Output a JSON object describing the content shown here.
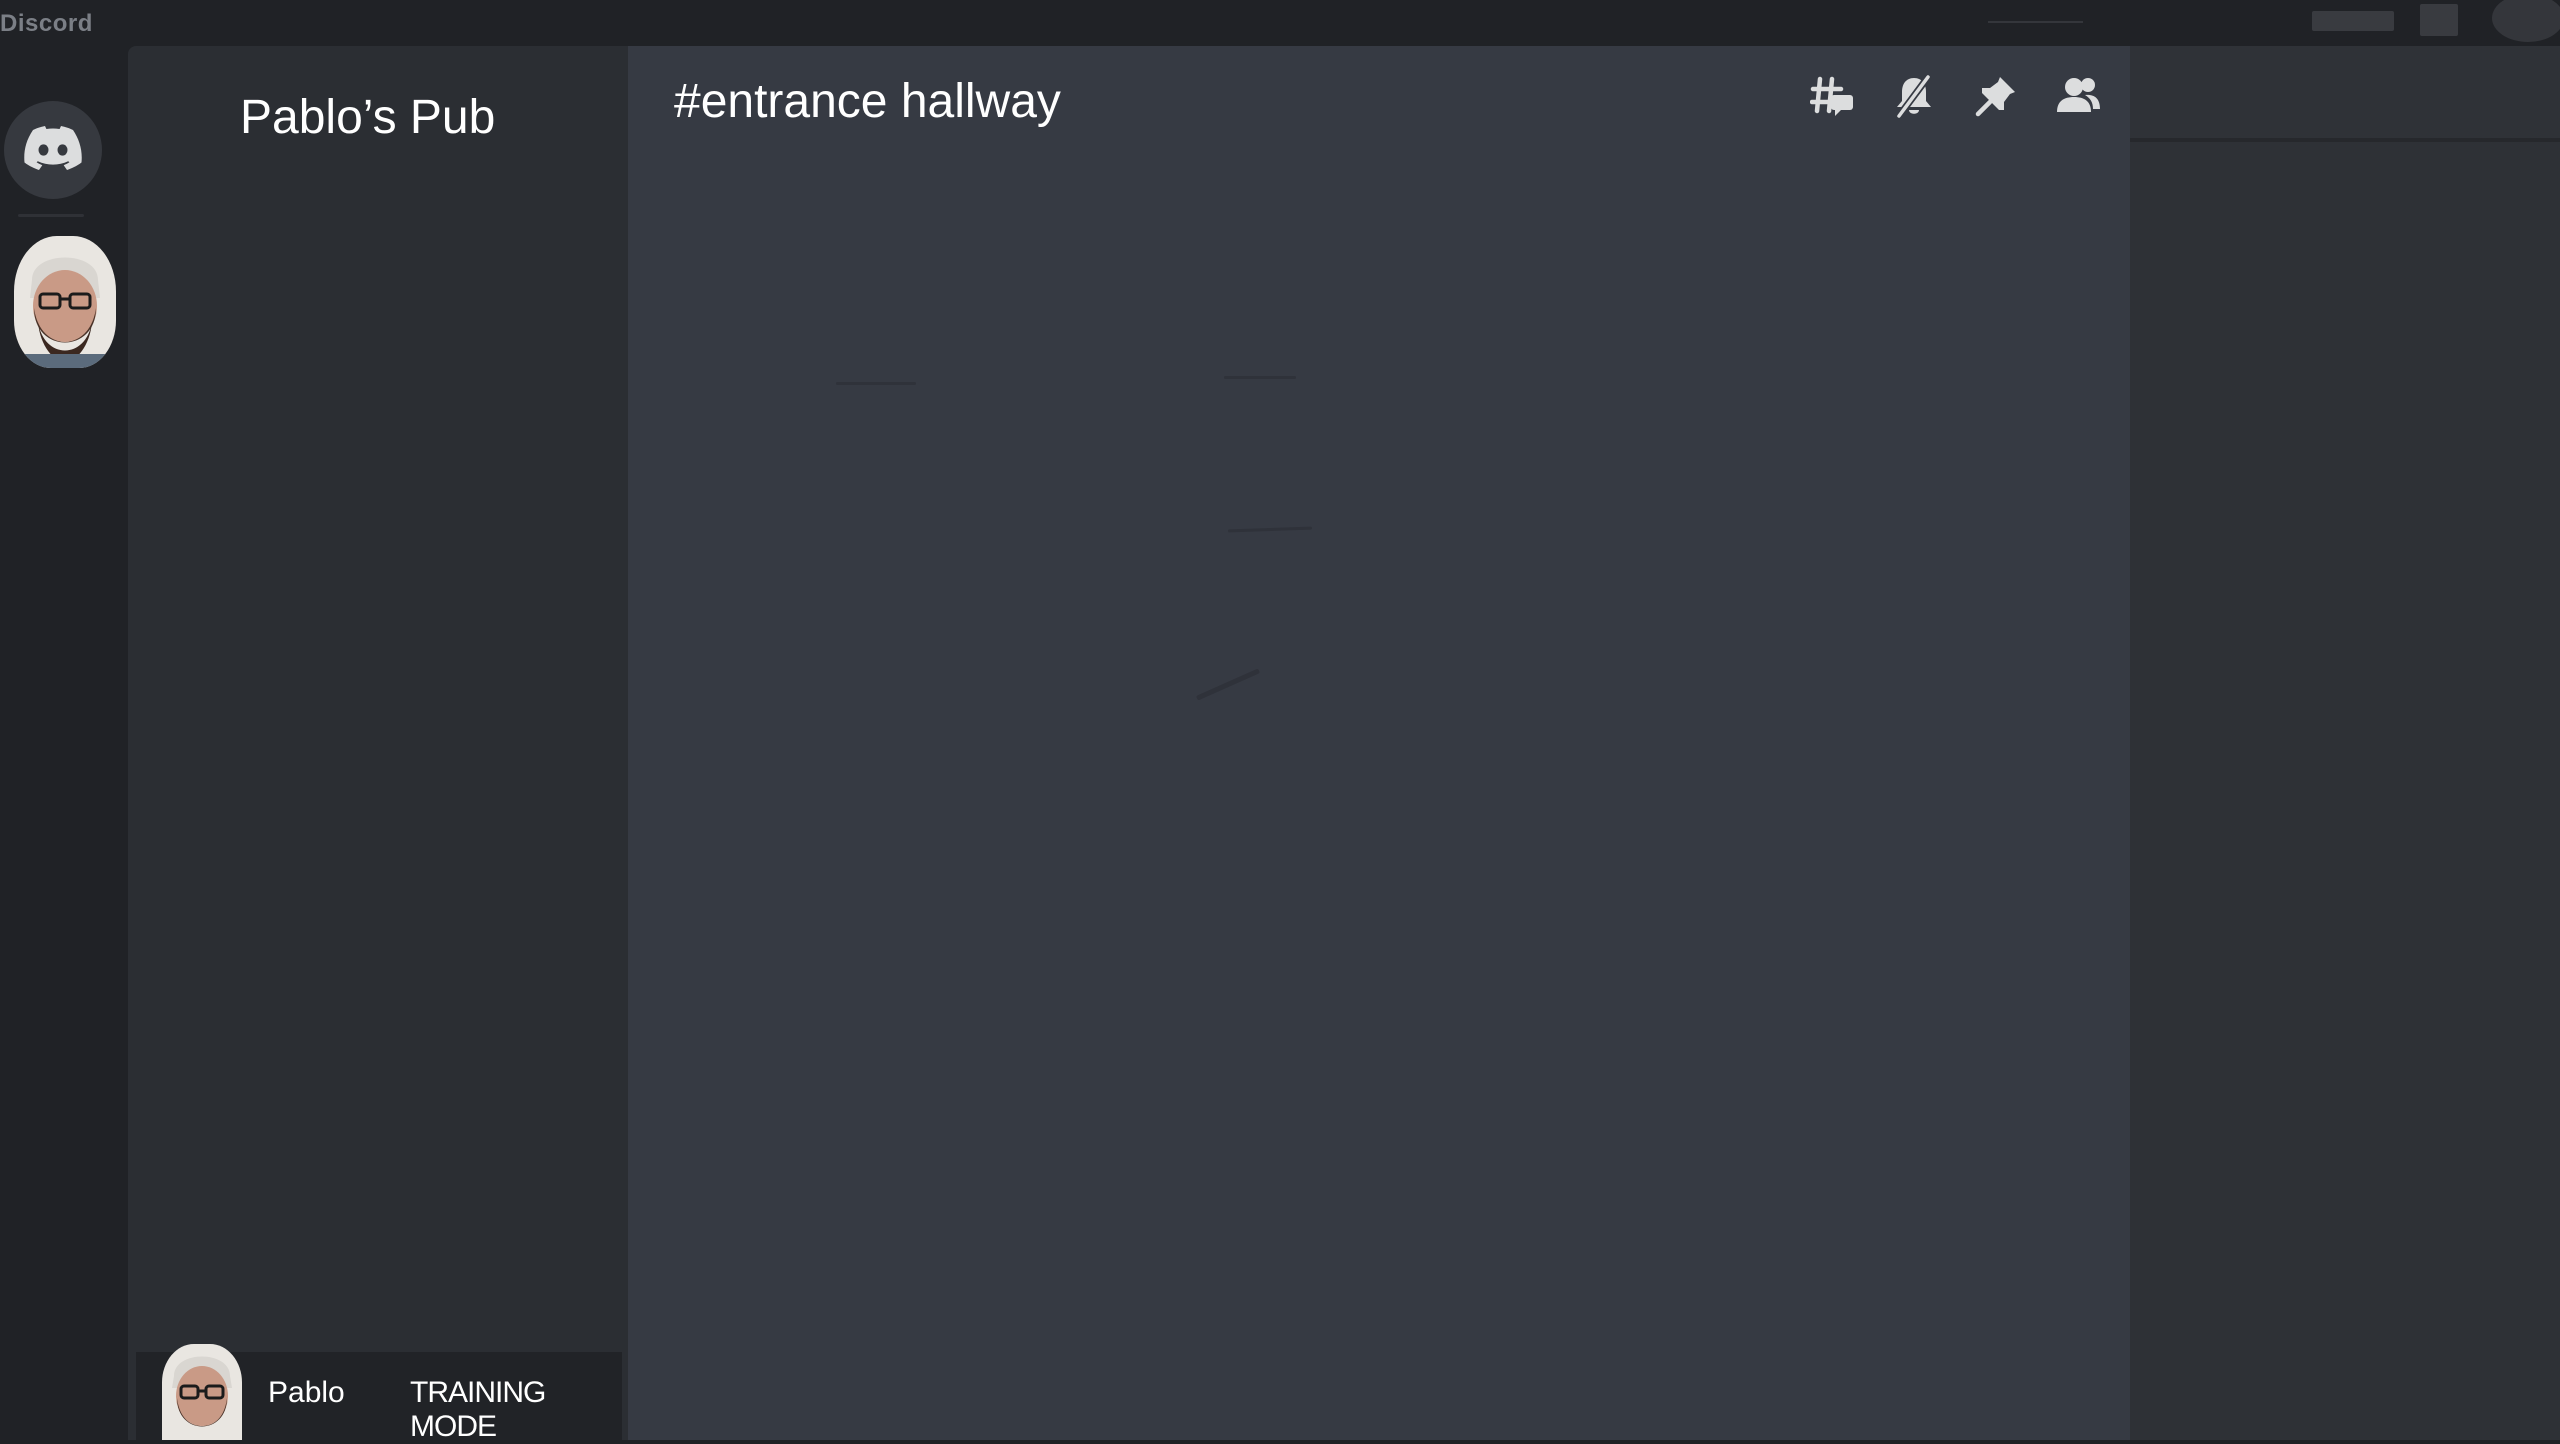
{
  "titlebar": {
    "app_name": "Discord"
  },
  "server_rail": {
    "home_icon": "discord-logo-icon",
    "servers": [
      {
        "icon": "pablo-avatar",
        "selected": true
      }
    ]
  },
  "sidebar": {
    "server_name": "Pablo’s Pub"
  },
  "user_panel": {
    "username": "Pablo",
    "status": "TRAINING MODE"
  },
  "chat": {
    "channel_title": "#entrance hallway",
    "header_icons": [
      "threads-icon",
      "mute-notifications-icon",
      "pin-icon",
      "members-icon"
    ]
  },
  "colors": {
    "rail_bg": "#202226",
    "sidebar_bg": "#2b2e33",
    "chat_bg": "#363a43",
    "member_list_bg": "#2e3136",
    "icon_color": "#dcddde",
    "text_color": "#ffffff"
  }
}
